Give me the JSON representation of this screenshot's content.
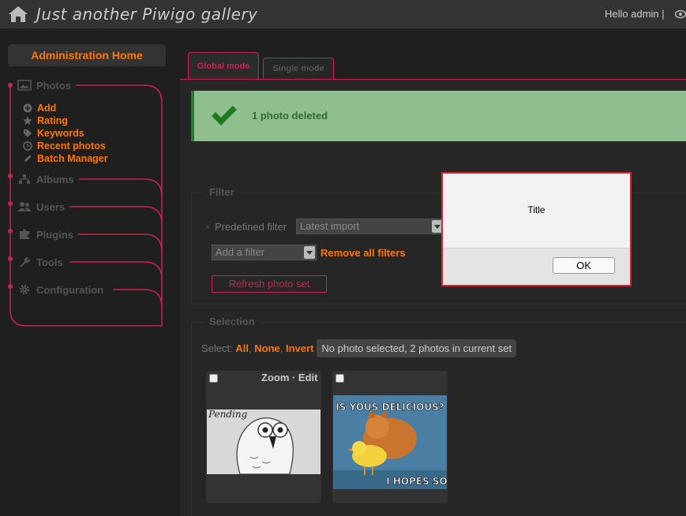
{
  "header": {
    "title": "Just another Piwigo gallery",
    "greeting": "Hello admin |"
  },
  "sidebar": {
    "admin_home": "Administration Home",
    "sections": {
      "photos": "Photos",
      "albums": "Albums",
      "users": "Users",
      "plugins": "Plugins",
      "tools": "Tools",
      "configuration": "Configuration"
    },
    "photo_items": [
      "Add",
      "Rating",
      "Keywords",
      "Recent photos",
      "Batch Manager"
    ]
  },
  "tabs": {
    "global": "Global mode",
    "single": "Single mode"
  },
  "message": {
    "text": "1 photo deleted"
  },
  "filter": {
    "legend": "Filter",
    "remove_mark": "×",
    "predefined_label": "Predefined filter",
    "predefined_value": "Latest import",
    "add_filter": "Add a filter",
    "remove_all": "Remove all filters",
    "refresh": "Refresh photo set"
  },
  "selection": {
    "legend": "Selection",
    "select_label": "Select:",
    "all": "All",
    "none": "None",
    "invert": "Invert",
    "sep": ",",
    "status": "No photo selected, 2 photos in current set",
    "zoom_edit": "Zoom · Edit",
    "thumb1_caption": "Pending",
    "thumb2_top": "IS YOUS DELICIOUS?",
    "thumb2_bottom": "I HOPES SO"
  },
  "dialog": {
    "title": "Title",
    "ok": "OK"
  },
  "colors": {
    "accent_orange": "#ff7700",
    "accent_red": "#c9234f",
    "success_bg": "#8fbf8f",
    "dialog_border": "#e0202a"
  }
}
